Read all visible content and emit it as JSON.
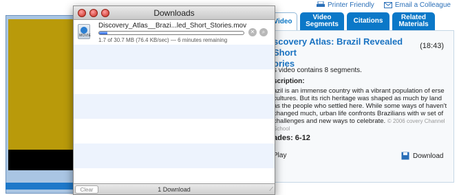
{
  "topbar": {
    "printer": "Printer Friendly",
    "email": "Email a Colleague"
  },
  "tabs": [
    "Video",
    "Video\nSegments",
    "Citations",
    "Related\nMaterials"
  ],
  "panel": {
    "title": "scovery Atlas: Brazil Revealed Short\nories",
    "duration": "(18:43)",
    "contains": "s video contains 8 segments.",
    "descLabel": "scription:",
    "desc": "azil is an immense country with a vibrant population of erse cultures. But its rich heritage was shaped as much by land as the people who settled here. While some ways of haven't changed much, urban life confronts Brazilians with w set of challenges and new ways to celebrate.",
    "copyright": "© 2006\ncovery Channel School",
    "grades": "ades: 6-12",
    "play": "Play",
    "download": "Download"
  },
  "downloads": {
    "title": "Downloads",
    "filename": "Discovery_Atlas__Brazi...led_Short_Stories.mov",
    "progress": 0.056,
    "status": "1.7 of 30.7 MB (76.4 KB/sec) — 6 minutes remaining",
    "clear": "Clear",
    "count": "1 Download",
    "icon_label": "MOVIE"
  }
}
